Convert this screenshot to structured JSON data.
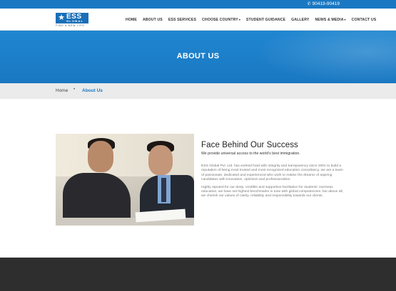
{
  "topbar": {
    "phone_icon": "phone-icon",
    "phone": "90419-90419",
    "bg_color": "#1a78c2"
  },
  "logo": {
    "mark": "ESS",
    "sub": "GLOBAL",
    "tagline": "FIND A NEW LIFE"
  },
  "nav": {
    "items": [
      {
        "label": "HOME",
        "dropdown": false
      },
      {
        "label": "ABOUT US",
        "dropdown": false
      },
      {
        "label": "ESS SERVICES",
        "dropdown": false
      },
      {
        "label": "CHOOSE COUNTRY",
        "dropdown": true
      },
      {
        "label": "STUDENT GUIDANCE",
        "dropdown": false
      },
      {
        "label": "GALLERY",
        "dropdown": false
      },
      {
        "label": "NEWS & MEDIA",
        "dropdown": true
      },
      {
        "label": "CONTACT US",
        "dropdown": false
      }
    ]
  },
  "banner": {
    "title": "ABOUT US"
  },
  "breadcrumb": {
    "home": "Home",
    "separator": "•",
    "current": "About Us"
  },
  "about": {
    "heading": "Face Behind Our Success",
    "subheading": "We provide universal access to the world's best immigration.",
    "paragraph1": "ESS Global Pvt. Ltd. has worked hard with integrity and transparency since 2001 to build a reputation of being most trusted and most recognized education consultancy. we are a team of passionate, dedicated and experienced who work to realise the dreams of aspiring candidates with innovation, optimism and professionalism.",
    "paragraph2": "Highly reputed for our deep, credible and supportive facilitation for students' overseas education, we have set highest benchmarks in tune with global competencies. but above all, we cherish our values of clarity, reliability and responsibility towards our clients."
  },
  "colors": {
    "accent": "#1a78c2",
    "footer": "#2e2e2e",
    "breadcrumb_bg": "#ebebeb"
  }
}
